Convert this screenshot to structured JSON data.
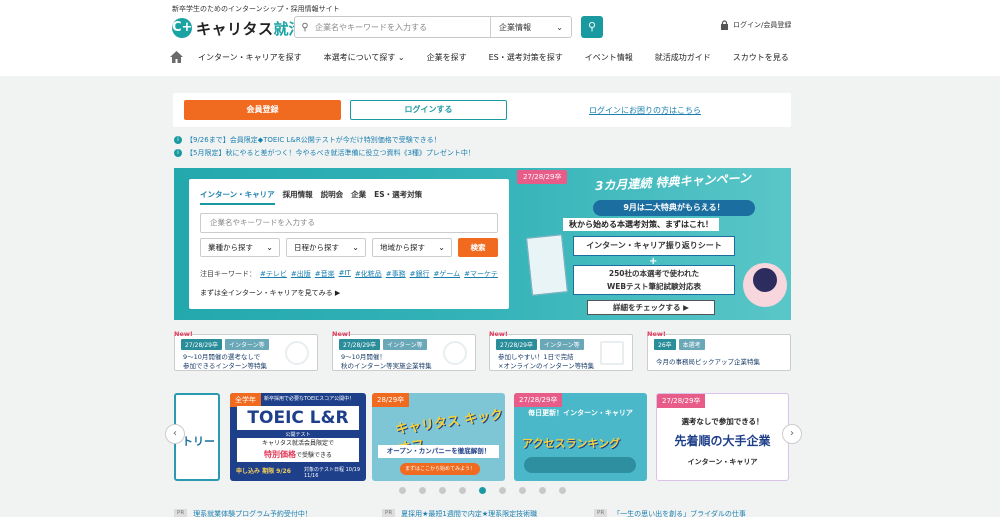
{
  "header": {
    "tagline": "新卒学生のためのインターンシップ・採用情報サイト",
    "logo_mark": "C+",
    "logo_text": "キャリタス",
    "logo_text2": "就活",
    "search_placeholder": "企業名やキーワードを入力する",
    "search_category": "企業情報",
    "login_label": "ログイン/会員登録"
  },
  "nav": {
    "items": [
      "インターン・キャリアを探す",
      "本選考について探す",
      "企業を探す",
      "ES・選考対策を探す",
      "イベント情報",
      "就活成功ガイド",
      "スカウトを見る"
    ]
  },
  "auth": {
    "register": "会員登録",
    "login": "ログインする",
    "help": "ログインにお困りの方はこちら"
  },
  "notices": [
    "【9/26まで】会員限定◆TOEIC L&R公開テストが今だけ特別価格で受験できる！",
    "【5月限定】秋にやると差がつく！今やるべき就活準備に役立つ資料《3種》プレゼント中！"
  ],
  "search_panel": {
    "tabs": [
      "インターン・キャリア",
      "採用情報",
      "説明会",
      "企業",
      "ES・選考対策"
    ],
    "placeholder": "企業名やキーワードを入力する",
    "selects": [
      "業種から探す",
      "日程から探す",
      "地域から探す"
    ],
    "search_button": "検索",
    "keyword_label": "注目キーワード：",
    "keywords": [
      "#テレビ",
      "#出版",
      "#音楽",
      "#IT",
      "#化粧品",
      "#事務",
      "#銀行",
      "#ゲーム",
      "#マーケテ"
    ],
    "all_link": "まずは全インターン・キャリアを見てみる ▶"
  },
  "campaign": {
    "year_tag": "27/28/29卒",
    "title": "3カ月連続 特典キャンペーン",
    "sub1": "9月は二大特典がもらえる！",
    "sub2": "秋から始める本選考対策、まずはこれ！",
    "item1": "インターン・キャリア振り返りシート",
    "plus": "+",
    "item2_line1": "250社の本選考で使われた",
    "item2_line2": "WEBテスト筆記試験対応表",
    "details": "詳細をチェックする ▶"
  },
  "news_cards": [
    {
      "new": "New!",
      "tags": [
        "27/28/29卒",
        "インターン等"
      ],
      "line1": "9～10月開催の選考なしで",
      "line2": "参加できるインターン等特集"
    },
    {
      "new": "New!",
      "tags": [
        "27/28/29卒",
        "インターン等"
      ],
      "line1": "9～10月開催！",
      "line2": "秋のインターン等実施企業特集"
    },
    {
      "new": "New!",
      "tags": [
        "27/28/29卒",
        "インターン等"
      ],
      "line1": "参加しやすい！1日で完結",
      "line2": "×オンラインのインターン等特集"
    },
    {
      "new": "New!",
      "tags": [
        "26卒",
        "本選考"
      ],
      "line1": "今月の事務局ピックアップ企業特集",
      "line2": ""
    }
  ],
  "banners": {
    "b0_text": "トリー",
    "b1_tag": "全学年",
    "b1_top": "新卒採用で必要なTOEICスコア公開中！",
    "b1_title": "TOEIC L&R",
    "b1_sub": "公開テスト",
    "b1_body1": "キャリタス就活会員限定で",
    "b1_body2": "特別価格",
    "b1_body3": "で受験できる",
    "b1_deadline": "申し込み 期限 9/26",
    "b1_date": "対象のテスト日程 10/19 11/16",
    "b2_tag": "28/29卒",
    "b2_title": "キャリタス キックオフ",
    "b2_sub": "オープン・カンパニーを徹底解剖！",
    "b2_cta": "まずはここから始めてみよう！",
    "b3_tag": "27/28/29卒",
    "b3_top": "毎日更新！インターン・キャリア",
    "b3_title": "アクセスランキング",
    "b4_tag": "27/28/29卒",
    "b4_top": "選考なしで参加できる！",
    "b4_title": "先着順の大手企業",
    "b4_sub": "インターン・キャリア"
  },
  "carousel": {
    "prev": "‹",
    "next": "›",
    "dot_count": 9,
    "active": 4
  },
  "bottom": [
    {
      "pr": "PR",
      "text": "理系就業体験プログラム予約受付中！"
    },
    {
      "pr": "PR",
      "text": "夏採用★最短1週間で内定★理系限定技術職"
    },
    {
      "pr": "PR",
      "text": "「一生の思い出を創る」ブライダルの仕事"
    }
  ]
}
